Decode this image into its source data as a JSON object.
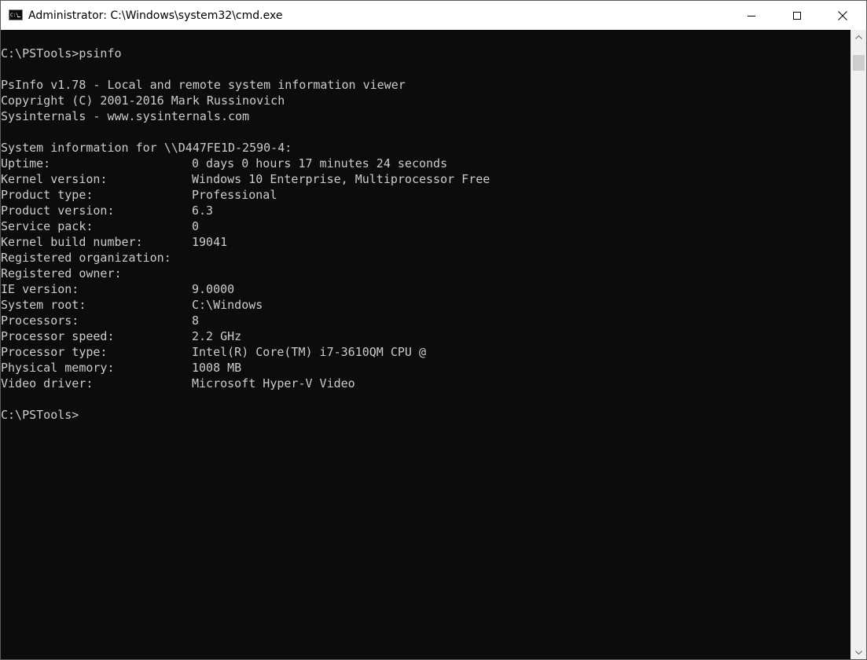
{
  "window": {
    "title": "Administrator: C:\\Windows\\system32\\cmd.exe",
    "app_icon": "cmd-icon",
    "buttons": {
      "minimize_icon": "minimize-icon",
      "maximize_icon": "maximize-icon",
      "close_icon": "close-icon"
    }
  },
  "console": {
    "colors": {
      "background": "#0c0c0c",
      "foreground": "#cccccc"
    },
    "command_line": "C:\\PSTools>psinfo",
    "banner": [
      "PsInfo v1.78 - Local and remote system information viewer",
      "Copyright (C) 2001-2016 Mark Russinovich",
      "Sysinternals - www.sysinternals.com"
    ],
    "system_header": "System information for \\\\D447FE1D-2590-4:",
    "rows": [
      {
        "label": "Uptime:",
        "value": "0 days 0 hours 17 minutes 24 seconds"
      },
      {
        "label": "Kernel version:",
        "value": "Windows 10 Enterprise, Multiprocessor Free"
      },
      {
        "label": "Product type:",
        "value": "Professional"
      },
      {
        "label": "Product version:",
        "value": "6.3"
      },
      {
        "label": "Service pack:",
        "value": "0"
      },
      {
        "label": "Kernel build number:",
        "value": "19041"
      },
      {
        "label": "Registered organization:",
        "value": ""
      },
      {
        "label": "Registered owner:",
        "value": ""
      },
      {
        "label": "IE version:",
        "value": "9.0000"
      },
      {
        "label": "System root:",
        "value": "C:\\Windows"
      },
      {
        "label": "Processors:",
        "value": "8"
      },
      {
        "label": "Processor speed:",
        "value": "2.2 GHz"
      },
      {
        "label": "Processor type:",
        "value": "Intel(R) Core(TM) i7-3610QM CPU @"
      },
      {
        "label": "Physical memory:",
        "value": "1008 MB"
      },
      {
        "label": "Video driver:",
        "value": "Microsoft Hyper-V Video"
      }
    ],
    "prompt": "C:\\PSTools>"
  },
  "scrollbar": {
    "up_icon": "scroll-up-arrow-icon",
    "down_icon": "scroll-down-arrow-icon"
  }
}
